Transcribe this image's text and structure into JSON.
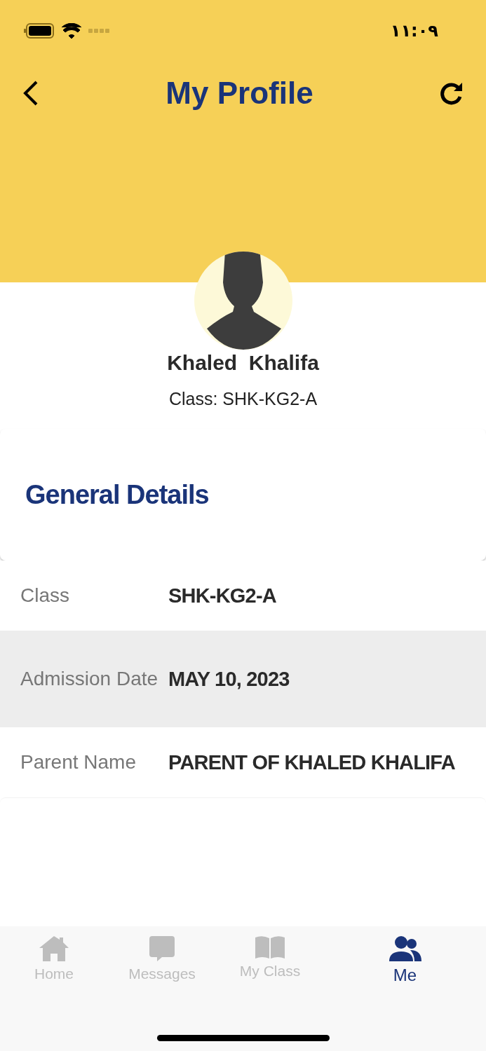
{
  "status_bar": {
    "time": "١١:٠٩"
  },
  "header": {
    "title": "My Profile"
  },
  "profile": {
    "name": "Khaled  Khalifa",
    "class_line": "Class: SHK-KG2-A"
  },
  "section": {
    "title": "General Details"
  },
  "details": [
    {
      "label": "Class",
      "value": "SHK-KG2-A",
      "shaded": false
    },
    {
      "label": "Admission Date",
      "value": "MAY 10, 2023",
      "shaded": true
    },
    {
      "label": "Parent Name",
      "value": "PARENT OF KHALED KHALIFA",
      "shaded": false
    }
  ],
  "tabs": [
    {
      "label": "Home",
      "kind": "home",
      "selected": false
    },
    {
      "label": "Messages",
      "kind": "messages",
      "selected": false
    },
    {
      "label": "My Class",
      "kind": "class",
      "selected": false
    },
    {
      "label": "Me",
      "kind": "me",
      "selected": true
    }
  ]
}
